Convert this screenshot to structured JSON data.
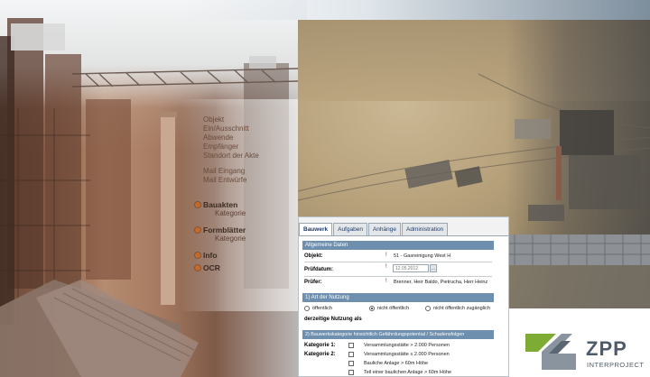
{
  "tabs": [
    {
      "label": "Bauwerk",
      "active": true
    },
    {
      "label": "Aufgaben",
      "active": false
    },
    {
      "label": "Anhänge",
      "active": false
    },
    {
      "label": "Administration",
      "active": false
    }
  ],
  "nav": {
    "items": [
      "Objekt",
      "Ein/Ausschnitt",
      "Abwende",
      "Empfänger",
      "Standort der Akte",
      "Mail Eingang",
      "Mail Entwürfe"
    ],
    "sections": [
      {
        "label": "Bauakten",
        "sub": "Kategorie"
      },
      {
        "label": "Formblätter",
        "sub": "Kategorie"
      },
      {
        "label": "Info"
      },
      {
        "label": "OCR"
      }
    ]
  },
  "form": {
    "section1_title": "Allgemeine Daten",
    "objekt_label": "Objekt:",
    "objekt_value": "51 - Gasreinigung West H",
    "pruefdatum_label": "Prüfdatum:",
    "pruefdatum_value": "12.05.2012",
    "pruefdatum_button": "...",
    "pruefer_label": "Prüfer:",
    "pruefer_value": "Brenner, Herr Baldo, Pietrucha, Herr Heinz",
    "required_mark": "!",
    "section2_title": "1) Art der Nutzung",
    "nutzung_options": [
      {
        "label": "öffentlich",
        "selected": false
      },
      {
        "label": "nicht öffentlich",
        "selected": true
      },
      {
        "label": "nicht öffentlich zugänglich",
        "selected": false
      }
    ],
    "derzeitige_label": "derzeitige Nutzung als",
    "section3_title": "2) Bauwerkskategorie hinsichtlich Gefährdungspotential / Schadensfolgen",
    "kategorie1_label": "Kategorie 1:",
    "kategorie2_label": "Kategorie 2:",
    "kategorie_options": [
      "Versammlungsstätte > 2.000 Personen",
      "Versammlungsstätte ≤ 2.000 Personen",
      "Bauliche Anlage > 60m Höhe",
      "Teil einer baulichen Anlage > 60m Höhe"
    ]
  },
  "logo": {
    "name": "ZPP",
    "subtitle": "INTERPROJECT",
    "colors": {
      "green": "#7dab34",
      "grey": "#8a949e",
      "dark": "#4f5b6a"
    }
  }
}
